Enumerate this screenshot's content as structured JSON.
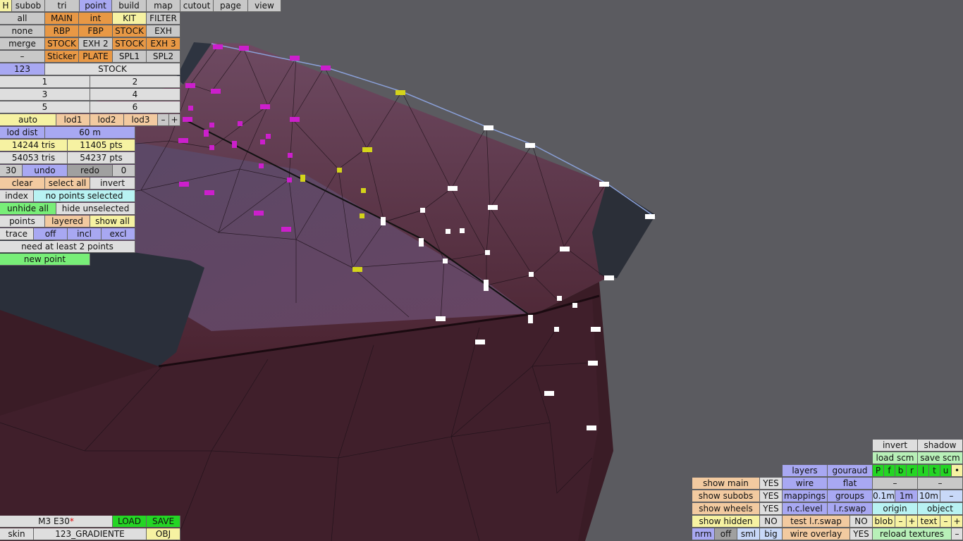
{
  "top_menu": {
    "h": "H",
    "subob": "subob",
    "tri": "tri",
    "point": "point",
    "build": "build",
    "map": "map",
    "cutout": "cutout",
    "page": "page",
    "view": "view"
  },
  "select_rows": [
    {
      "left": "all",
      "parts": [
        "MAIN",
        "int",
        "KIT",
        "FILTER"
      ]
    },
    {
      "left": "none",
      "parts": [
        "RBP",
        "FBP",
        "STOCK",
        "EXH"
      ]
    },
    {
      "left": "merge",
      "parts": [
        "STOCK",
        "EXH 2",
        "STOCK",
        "EXH 3"
      ]
    },
    {
      "left": "–",
      "parts": [
        "Sticker",
        "PLATE",
        "SPL1",
        "SPL2"
      ]
    }
  ],
  "layer_num": "123",
  "layer_name": "STOCK",
  "slots": [
    "1",
    "2",
    "3",
    "4",
    "5",
    "6"
  ],
  "lod": {
    "auto": "auto",
    "lod1": "lod1",
    "lod2": "lod2",
    "lod3": "lod3",
    "minus": "–",
    "plus": "+",
    "dist_label": "lod dist",
    "dist_value": "60 m"
  },
  "stats": {
    "tris_sel": "14244 tris",
    "pts_sel": "11405 pts",
    "tris_total": "54053 tris",
    "pts_total": "54237 pts"
  },
  "undo": {
    "count": "30",
    "undo": "undo",
    "redo": "redo",
    "redo_count": "0"
  },
  "selection": {
    "clear": "clear",
    "select_all": "select all",
    "invert": "invert",
    "index": "index",
    "status": "no points selected",
    "unhide_all": "unhide all",
    "hide_unselected": "hide unselected"
  },
  "points_row": {
    "points": "points",
    "layered": "layered",
    "show_all": "show all"
  },
  "trace_row": {
    "trace": "trace",
    "off": "off",
    "incl": "incl",
    "excl": "excl"
  },
  "need_msg": "need at least 2 points",
  "new_point": "new point",
  "footer_left": {
    "model": "M3 E30",
    "modified_mark": "*",
    "load": "LOAD",
    "save": "SAVE",
    "skin": "skin",
    "skin_name": "123_GRADIENTE",
    "obj": "OBJ"
  },
  "bottom_right": {
    "invert": "invert",
    "shadow": "shadow",
    "load_scm": "load scm",
    "save_scm": "save scm",
    "layers": "layers",
    "gouraud": "gouraud",
    "views": [
      "P",
      "f",
      "b",
      "r",
      "l",
      "t",
      "u",
      "•"
    ],
    "show_main": "show main",
    "show_main_v": "YES",
    "wire": "wire",
    "flat": "flat",
    "dash1": "–",
    "dash2": "–",
    "show_subobs": "show subobs",
    "show_subobs_v": "YES",
    "mappings": "mappings",
    "groups": "groups",
    "grid": [
      "0.1m",
      "1m",
      "10m",
      "–"
    ],
    "show_wheels": "show wheels",
    "show_wheels_v": "YES",
    "nc_level": "n.c.level",
    "lr_swap": "l.r.swap",
    "origin": "origin",
    "object": "object",
    "show_hidden": "show hidden",
    "show_hidden_v": "NO",
    "test_lr_swap": "test l.r.swap",
    "test_lr_swap_v": "NO",
    "blob": "blob",
    "text": "text",
    "minus": "–",
    "plus": "+",
    "sizes": [
      "nrm",
      "off",
      "sml",
      "big"
    ],
    "wire_overlay": "wire overlay",
    "wire_overlay_v": "YES",
    "reload_textures": "reload textures"
  }
}
